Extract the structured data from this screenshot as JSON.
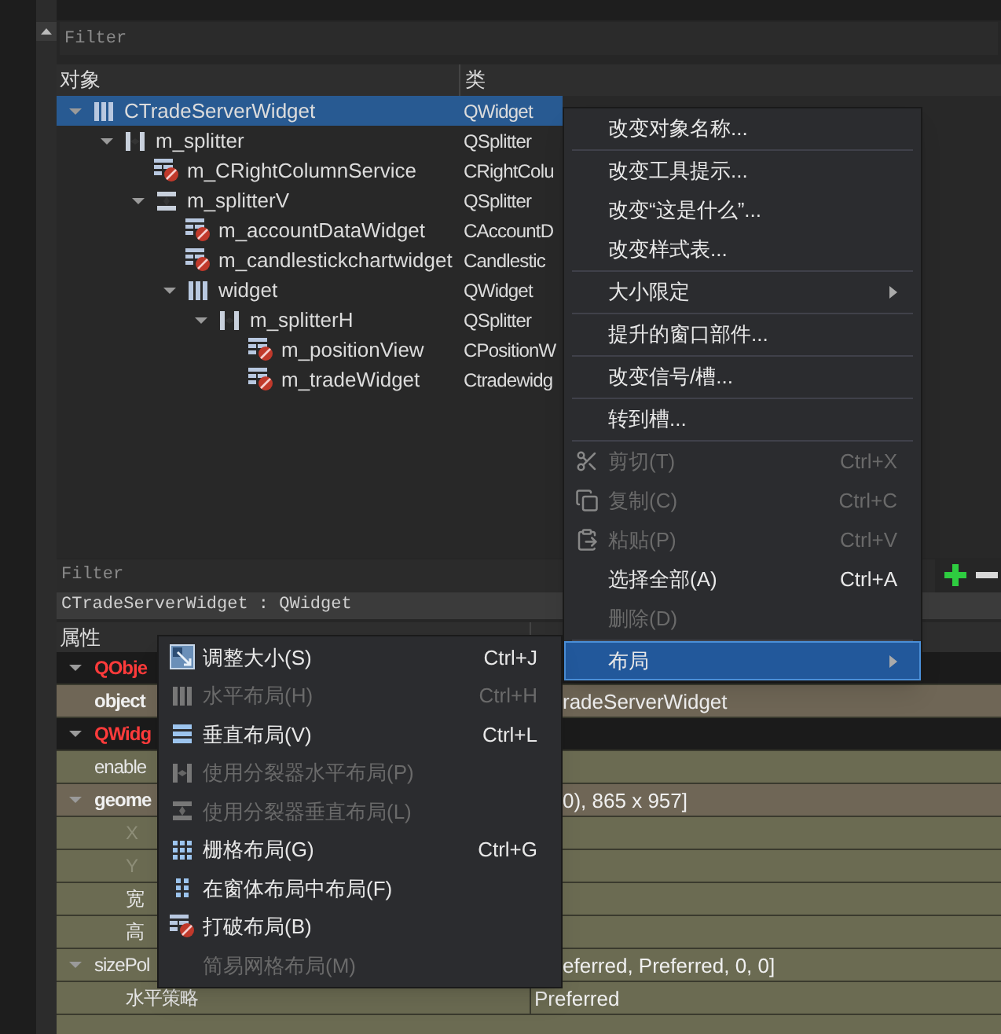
{
  "filter": {
    "placeholder": "Filter"
  },
  "object_tree": {
    "columns": [
      "对象",
      "类"
    ],
    "rows": [
      {
        "name": "CTradeServerWidget",
        "class": "QWidget",
        "kind": "horizontal_layout",
        "selected": true,
        "expanded": true,
        "children": [
          {
            "name": "m_splitter",
            "class": "QSplitter",
            "kind": "horizontal_splitter",
            "selected": false,
            "expanded": true,
            "children": [
              {
                "name": "m_CRightColumnService",
                "class": "CRightColu",
                "kind": "no_layout",
                "selected": false
              },
              {
                "name": "m_splitterV",
                "class": "QSplitter",
                "kind": "vertical_splitter",
                "selected": false,
                "expanded": true,
                "children": [
                  {
                    "name": "m_accountDataWidget",
                    "class": "CAccountD",
                    "kind": "no_layout",
                    "selected": false
                  },
                  {
                    "name": "m_candlestickchartwidget",
                    "class": "Candlestic",
                    "kind": "no_layout",
                    "selected": false
                  },
                  {
                    "name": "widget",
                    "class": "QWidget",
                    "kind": "horizontal_layout",
                    "selected": false,
                    "expanded": true,
                    "children": [
                      {
                        "name": "m_splitterH",
                        "class": "QSplitter",
                        "kind": "horizontal_splitter",
                        "selected": false,
                        "expanded": true,
                        "children": [
                          {
                            "name": "m_positionView",
                            "class": "CPositionW",
                            "kind": "no_layout",
                            "selected": false
                          },
                          {
                            "name": "m_tradeWidget",
                            "class": "Ctradewidg",
                            "kind": "no_layout",
                            "selected": false
                          }
                        ]
                      }
                    ]
                  }
                ]
              }
            ]
          }
        ]
      }
    ]
  },
  "property_filter": {
    "placeholder": "Filter"
  },
  "class_label": "CTradeServerWidget : QWidget",
  "property_table": {
    "column": "属性",
    "rows": [
      {
        "name": "QObje",
        "kind": "class",
        "expanded": true,
        "children": [
          {
            "name": "object",
            "value": "radeServerWidget",
            "kind": "modified"
          }
        ]
      },
      {
        "name": "QWidg",
        "kind": "class",
        "expanded": true,
        "children": [
          {
            "name": "enable",
            "kind": "property"
          },
          {
            "name": "geome",
            "value": "0), 865 x 957]",
            "kind": "modified",
            "expanded": true,
            "children": [
              {
                "name": "X",
                "kind": "property",
                "disabled": true
              },
              {
                "name": "Y",
                "kind": "property",
                "disabled": true
              },
              {
                "name": "宽",
                "kind": "property",
                "disabled": false
              },
              {
                "name": "高",
                "kind": "property",
                "disabled": false
              }
            ]
          },
          {
            "name": "sizePol",
            "value": "eferred, Preferred, 0, 0]",
            "kind": "property",
            "expanded": true,
            "children": [
              {
                "name": "水平策略",
                "value": "Preferred",
                "kind": "property",
                "disabled": false
              }
            ]
          }
        ]
      }
    ]
  },
  "context_menu": {
    "items": [
      {
        "kind": "action",
        "label": "改变对象名称...",
        "disabled": false,
        "selected": false
      },
      {
        "kind": "separator"
      },
      {
        "kind": "action",
        "label": "改变工具提示...",
        "disabled": false,
        "selected": false
      },
      {
        "kind": "action",
        "label": "改变“这是什么”...",
        "disabled": false,
        "selected": false
      },
      {
        "kind": "action",
        "label": "改变样式表...",
        "disabled": false,
        "selected": false
      },
      {
        "kind": "separator"
      },
      {
        "kind": "submenu",
        "label": "大小限定",
        "disabled": false,
        "selected": false
      },
      {
        "kind": "separator"
      },
      {
        "kind": "action",
        "label": "提升的窗口部件...",
        "disabled": false,
        "selected": false
      },
      {
        "kind": "separator"
      },
      {
        "kind": "action",
        "label": "改变信号/槽...",
        "disabled": false,
        "selected": false
      },
      {
        "kind": "separator"
      },
      {
        "kind": "action",
        "label": "转到槽...",
        "disabled": false,
        "selected": false
      },
      {
        "kind": "separator"
      },
      {
        "kind": "action",
        "label": "剪切(T)",
        "shortcut": "Ctrl+X",
        "disabled": true,
        "selected": false
      },
      {
        "kind": "action",
        "label": "复制(C)",
        "shortcut": "Ctrl+C",
        "disabled": true,
        "selected": false
      },
      {
        "kind": "action",
        "label": "粘贴(P)",
        "shortcut": "Ctrl+V",
        "disabled": true,
        "selected": false
      },
      {
        "kind": "action",
        "label": "选择全部(A)",
        "shortcut": "Ctrl+A",
        "disabled": false,
        "selected": false
      },
      {
        "kind": "action",
        "label": "删除(D)",
        "disabled": true,
        "selected": false
      },
      {
        "kind": "separator"
      },
      {
        "kind": "submenu",
        "label": "布局",
        "disabled": false,
        "selected": true
      }
    ]
  },
  "layout_submenu": {
    "items": [
      {
        "label": "调整大小(S)",
        "shortcut": "Ctrl+J",
        "disabled": false,
        "selected": false
      },
      {
        "label": "水平布局(H)",
        "shortcut": "Ctrl+H",
        "disabled": true,
        "selected": false
      },
      {
        "label": "垂直布局(V)",
        "shortcut": "Ctrl+L",
        "disabled": false,
        "selected": false
      },
      {
        "label": "使用分裂器水平布局(P)",
        "disabled": true,
        "selected": false
      },
      {
        "label": "使用分裂器垂直布局(L)",
        "disabled": true,
        "selected": false
      },
      {
        "label": "栅格布局(G)",
        "shortcut": "Ctrl+G",
        "disabled": false,
        "selected": false
      },
      {
        "label": "在窗体布局中布局(F)",
        "disabled": false,
        "selected": false
      },
      {
        "label": "打破布局(B)",
        "disabled": false,
        "selected": false
      },
      {
        "label": "简易网格布局(M)",
        "disabled": true,
        "selected": false
      }
    ]
  }
}
